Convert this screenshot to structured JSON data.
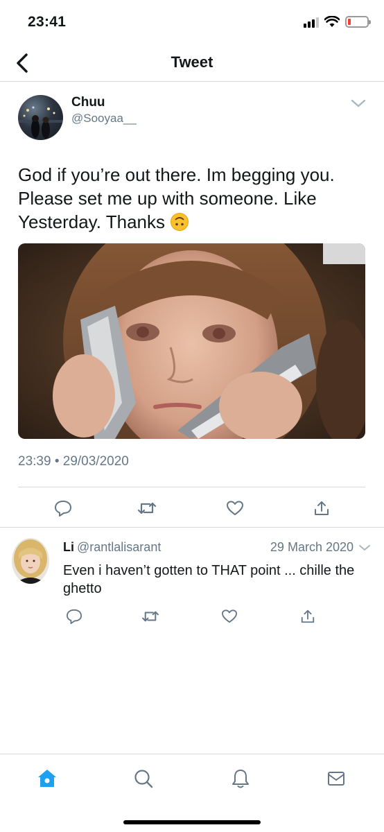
{
  "status_bar": {
    "time": "23:41"
  },
  "nav": {
    "title": "Tweet"
  },
  "tweet": {
    "author_name": "Chuu",
    "author_handle": "@Sooyaa__",
    "text": "God if you’re out there. Im begging you. Please set me up with someone. Like Yesterday. Thanks",
    "emoji": "upside-down-face-emoji",
    "timestamp": "23:39 • 29/03/2020"
  },
  "reply": {
    "author_name": "Li",
    "author_handle": "@rantlalisarant",
    "date": "29 March 2020",
    "text": "Even i haven’t gotten to THAT point ... chille the ghetto"
  },
  "icons": {
    "back": "chevron-left-icon",
    "caret": "chevron-down-icon",
    "reply": "reply-icon",
    "retweet": "retweet-icon",
    "like": "heart-icon",
    "share": "share-icon",
    "home": "home-icon",
    "search": "search-icon",
    "notifications": "bell-icon",
    "messages": "mail-icon"
  },
  "colors": {
    "accent": "#1da1f2",
    "text_secondary": "#657786",
    "battery_low": "#ff3b30"
  }
}
